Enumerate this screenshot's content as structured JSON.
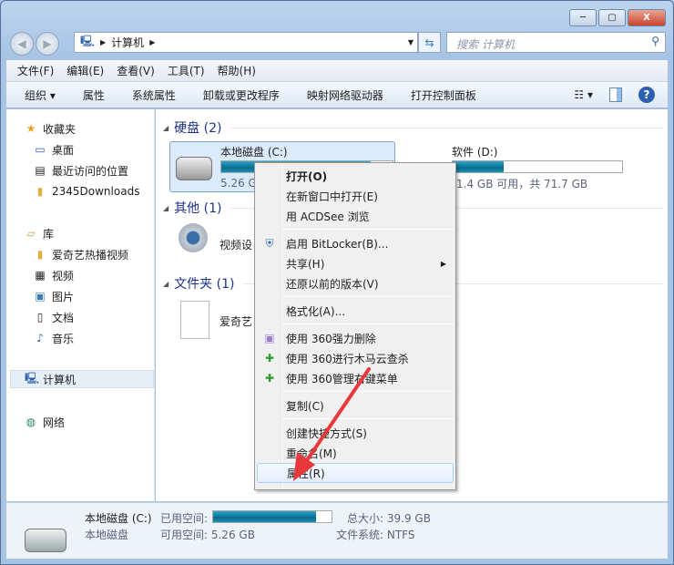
{
  "window": {
    "controls": {
      "minimize": "─",
      "maximize": "▢",
      "close": "X"
    }
  },
  "address": {
    "crumb": "计算机",
    "search_placeholder": "搜索 计算机"
  },
  "menubar": [
    "文件(F)",
    "编辑(E)",
    "查看(V)",
    "工具(T)",
    "帮助(H)"
  ],
  "toolbar": [
    "组织 ▾",
    "属性",
    "系统属性",
    "卸载或更改程序",
    "映射网络驱动器",
    "打开控制面板"
  ],
  "sidebar": {
    "favorites": "收藏夹",
    "desktop": "桌面",
    "recent": "最近访问的位置",
    "downloads": "2345Downloads",
    "libraries": "库",
    "iqiyi": "爱奇艺热播视频",
    "videos": "视频",
    "pictures": "图片",
    "docs": "文档",
    "music": "音乐",
    "computer": "计算机",
    "network": "网络"
  },
  "content": {
    "groups": {
      "hdd": "硬盘 (2)",
      "other": "其他 (1)",
      "folders": "文件夹 (1)"
    },
    "c_drive": {
      "name": "本地磁盘 (C:)",
      "free": "5.26 G",
      "used_fraction": 0.87
    },
    "d_drive": {
      "name": "软件 (D:)",
      "free": "1.4 GB 可用，共 71.7 GB",
      "used_fraction": 0.3
    },
    "video_device": "视频设",
    "folder": "爱奇艺"
  },
  "context_menu": [
    {
      "label": "打开(O)",
      "bold": true
    },
    {
      "label": "在新窗口中打开(E)"
    },
    {
      "label": "用 ACDSee 浏览"
    },
    {
      "label": "启用 BitLocker(B)...",
      "icon": "shield-icon"
    },
    {
      "label": "共享(H)",
      "submenu": true
    },
    {
      "label": "还原以前的版本(V)"
    },
    {
      "label": "格式化(A)..."
    },
    {
      "label": "使用 360强力删除",
      "icon": "360-shred-icon"
    },
    {
      "label": "使用 360进行木马云查杀",
      "icon": "360-scan-icon"
    },
    {
      "label": "使用 360管理右键菜单",
      "icon": "360-menu-icon"
    },
    {
      "label": "复制(C)"
    },
    {
      "label": "创建快捷方式(S)"
    },
    {
      "label": "重命名(M)"
    },
    {
      "label": "属性(R)",
      "highlighted": true
    }
  ],
  "status": {
    "name": "本地磁盘 (C:)",
    "type": "本地磁盘",
    "used_label": "已用空间:",
    "free_label": "可用空间: 5.26 GB",
    "total": "总大小: 39.9 GB",
    "fs": "文件系统: NTFS",
    "used_fraction": 0.87
  },
  "colors": {
    "accent": "#1e3287",
    "arrow": "#e8383a",
    "bar": "#0a6c8e"
  }
}
